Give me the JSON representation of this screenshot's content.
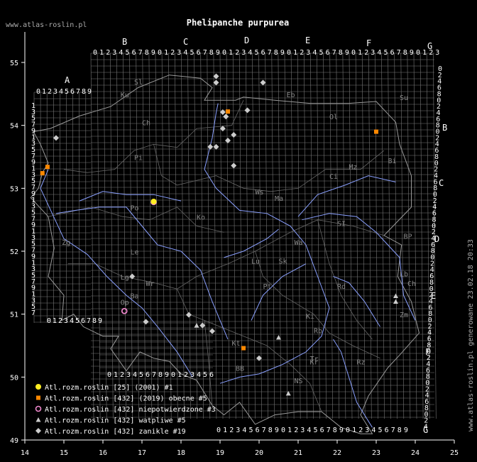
{
  "header": {
    "site": "www.atlas-roslin.pl",
    "title": "Phelipanche purpurea"
  },
  "stamp": "www.atlas-roslin.pl generowane 23.02.18 20:33",
  "axes": {
    "x_ticks": [
      "14",
      "15",
      "16",
      "17",
      "18",
      "19",
      "20",
      "21",
      "22",
      "23",
      "24",
      "25"
    ],
    "y_ticks": [
      "55",
      "54",
      "53",
      "52",
      "51",
      "50",
      "49"
    ]
  },
  "grid_letters_top": [
    "A",
    "B",
    "C",
    "D",
    "E",
    "F",
    "G"
  ],
  "grid_letters_right": [
    "B",
    "C",
    "D",
    "E",
    "F",
    "G"
  ],
  "digits": "0123456789",
  "regions": [
    "Sl",
    "Ku",
    "Eb",
    "Ch",
    "Ol",
    "Su",
    "Pi",
    "Bi",
    "Ci",
    "Ws",
    "Ma",
    "Ko",
    "Po",
    "SI",
    "Mz",
    "Wa",
    "BP",
    "Sk",
    "Lu",
    "Zg",
    "Le",
    "Pt",
    "Rd",
    "Lb",
    "Lg",
    "Wr",
    "Ch",
    "Ki",
    "Zm",
    "Op",
    "Rb",
    "Kt",
    "Tr",
    "Rz",
    "BB",
    "NS",
    "Ba",
    "Kr"
  ],
  "colors": {
    "background": "#000000",
    "grid": "#777777",
    "border": "#9a9a9a",
    "river": "#8aa0ff",
    "yellow": "#ffee22",
    "orange": "#ff8800",
    "pink": "#ee88cc",
    "gray": "#cccccc"
  },
  "legend": [
    {
      "marker": "yellow-dot",
      "label": "Atl.rozm.roslin [25] (2001) #1"
    },
    {
      "marker": "orange-square",
      "label": "Atl.rozm.roslin [432] (2019) obecne #5"
    },
    {
      "marker": "pink-ring",
      "label": "Atl.rozm.roslin [432] niepotwierdzone #3"
    },
    {
      "marker": "gray-triangle",
      "label": "Atl.rozm.roslin [432] watpliwe #5"
    },
    {
      "marker": "gray-diamond",
      "label": "Atl.rozm.roslin [432] zanikle #19"
    }
  ],
  "records": {
    "yellow_dot": [
      [
        17.3,
        52.79
      ]
    ],
    "orange_square": [
      [
        14.58,
        53.34
      ],
      [
        14.45,
        53.24
      ],
      [
        19.2,
        54.22
      ],
      [
        19.6,
        50.46
      ],
      [
        23.0,
        53.9
      ]
    ],
    "pink_ring": [
      [
        17.3,
        52.78
      ],
      [
        16.55,
        51.05
      ],
      [
        16.55,
        51.05
      ]
    ],
    "gray_triangle": [
      [
        18.4,
        50.82
      ],
      [
        20.5,
        50.63
      ],
      [
        20.75,
        49.74
      ],
      [
        23.5,
        51.29
      ],
      [
        23.5,
        51.2
      ]
    ],
    "gray_diamond": [
      [
        18.9,
        54.78
      ],
      [
        18.9,
        54.68
      ],
      [
        20.1,
        54.68
      ],
      [
        19.07,
        54.21
      ],
      [
        19.7,
        54.24
      ],
      [
        19.15,
        54.14
      ],
      [
        19.07,
        53.95
      ],
      [
        19.35,
        53.85
      ],
      [
        19.2,
        53.76
      ],
      [
        18.75,
        53.66
      ],
      [
        18.9,
        53.66
      ],
      [
        19.35,
        53.36
      ],
      [
        14.8,
        53.8
      ],
      [
        16.75,
        51.6
      ],
      [
        17.1,
        50.88
      ],
      [
        18.2,
        50.99
      ],
      [
        18.55,
        50.82
      ],
      [
        18.8,
        50.73
      ],
      [
        20.0,
        50.3
      ]
    ]
  }
}
